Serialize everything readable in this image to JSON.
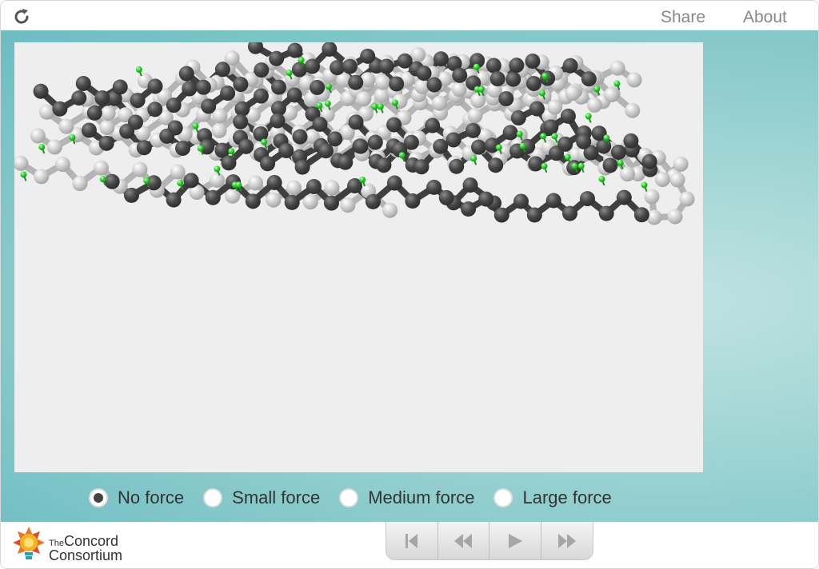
{
  "header": {
    "share_label": "Share",
    "about_label": "About",
    "reload_icon": "reload-icon"
  },
  "force_options": {
    "selected": "No force",
    "options": [
      "No force",
      "Small force",
      "Medium force",
      "Large force"
    ]
  },
  "footer": {
    "logo_line1_the": "The",
    "logo_line1": "Concord",
    "logo_line2": "Consortium",
    "player_icons": [
      "skip-to-start-icon",
      "step-back-icon",
      "play-icon",
      "step-forward-icon"
    ]
  },
  "colors": {
    "stage_teal": "#85c8ca",
    "model_background": "#eeeeee",
    "dark_atom": "#484848",
    "light_atom": "#c4c4c4",
    "hydrogen_bond": "#22cc22"
  }
}
